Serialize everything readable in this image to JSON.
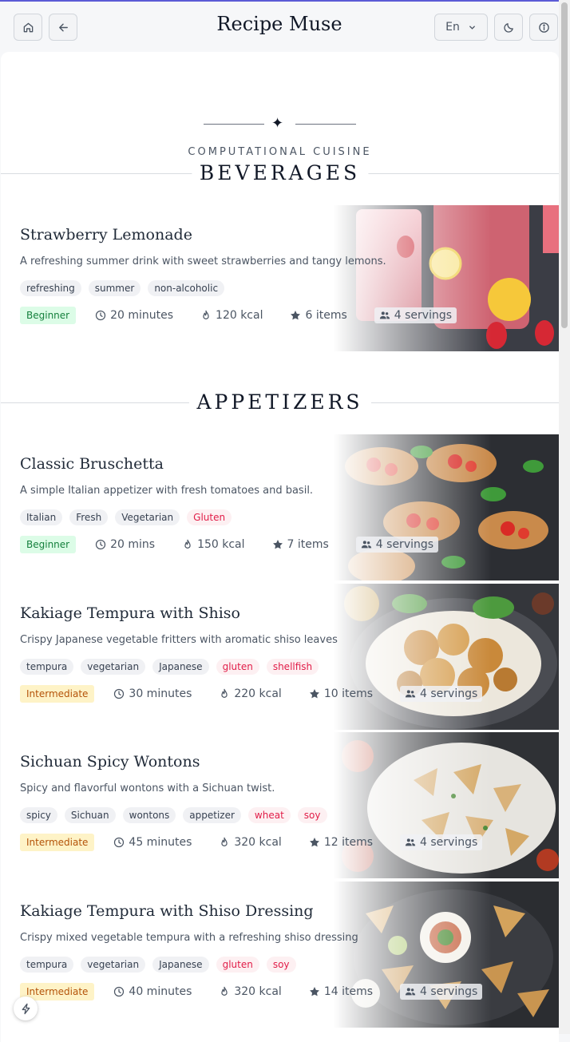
{
  "header": {
    "title": "Recipe Muse",
    "language": "En",
    "icons": [
      "home-icon",
      "arrow-left-icon",
      "chevron-down-icon",
      "moon-icon",
      "info-icon"
    ]
  },
  "hero": {
    "ornament": "✦",
    "kicker": "COMPUTATIONAL CUISINE"
  },
  "sections": [
    {
      "label": "BEVERAGES",
      "recipes": [
        {
          "title": "Strawberry Lemonade",
          "description": "A refreshing summer drink with sweet strawberries and tangy lemons.",
          "tags": [
            {
              "label": "refreshing",
              "allergen": false
            },
            {
              "label": "summer",
              "allergen": false
            },
            {
              "label": "non-alcoholic",
              "allergen": false
            }
          ],
          "level": "Beginner",
          "time": "20 minutes",
          "calories": "120 kcal",
          "ingredients": "6 items",
          "servings": "4 servings"
        }
      ]
    },
    {
      "label": "APPETIZERS",
      "recipes": [
        {
          "title": "Classic Bruschetta",
          "description": "A simple Italian appetizer with fresh tomatoes and basil.",
          "tags": [
            {
              "label": "Italian",
              "allergen": false
            },
            {
              "label": "Fresh",
              "allergen": false
            },
            {
              "label": "Vegetarian",
              "allergen": false
            },
            {
              "label": "Gluten",
              "allergen": true
            }
          ],
          "level": "Beginner",
          "time": "20 mins",
          "calories": "150 kcal",
          "ingredients": "7 items",
          "servings": "4 servings"
        },
        {
          "title": "Kakiage Tempura with Shiso",
          "description": "Crispy Japanese vegetable fritters with aromatic shiso leaves",
          "tags": [
            {
              "label": "tempura",
              "allergen": false
            },
            {
              "label": "vegetarian",
              "allergen": false
            },
            {
              "label": "Japanese",
              "allergen": false
            },
            {
              "label": "gluten",
              "allergen": true
            },
            {
              "label": "shellfish",
              "allergen": true
            }
          ],
          "level": "Intermediate",
          "time": "30 minutes",
          "calories": "220 kcal",
          "ingredients": "10 items",
          "servings": "4 servings"
        },
        {
          "title": "Sichuan Spicy Wontons",
          "description": "Spicy and flavorful wontons with a Sichuan twist.",
          "tags": [
            {
              "label": "spicy",
              "allergen": false
            },
            {
              "label": "Sichuan",
              "allergen": false
            },
            {
              "label": "wontons",
              "allergen": false
            },
            {
              "label": "appetizer",
              "allergen": false
            },
            {
              "label": "wheat",
              "allergen": true
            },
            {
              "label": "soy",
              "allergen": true
            }
          ],
          "level": "Intermediate",
          "time": "45 minutes",
          "calories": "320 kcal",
          "ingredients": "12 items",
          "servings": "4 servings"
        },
        {
          "title": "Kakiage Tempura with Shiso Dressing",
          "description": "Crispy mixed vegetable tempura with a refreshing shiso dressing",
          "tags": [
            {
              "label": "tempura",
              "allergen": false
            },
            {
              "label": "vegetarian",
              "allergen": false
            },
            {
              "label": "Japanese",
              "allergen": false
            },
            {
              "label": "gluten",
              "allergen": true
            },
            {
              "label": "soy",
              "allergen": true
            }
          ],
          "level": "Intermediate",
          "time": "40 minutes",
          "calories": "320 kcal",
          "ingredients": "14 items",
          "servings": "4 servings"
        }
      ]
    }
  ],
  "colors": {
    "accent": "#5b5bd6",
    "beginner_bg": "#dcfce7",
    "beginner_text": "#15803d",
    "intermediate_bg": "#fef3c7",
    "intermediate_text": "#b45309",
    "allergen_text": "#e11d48"
  }
}
